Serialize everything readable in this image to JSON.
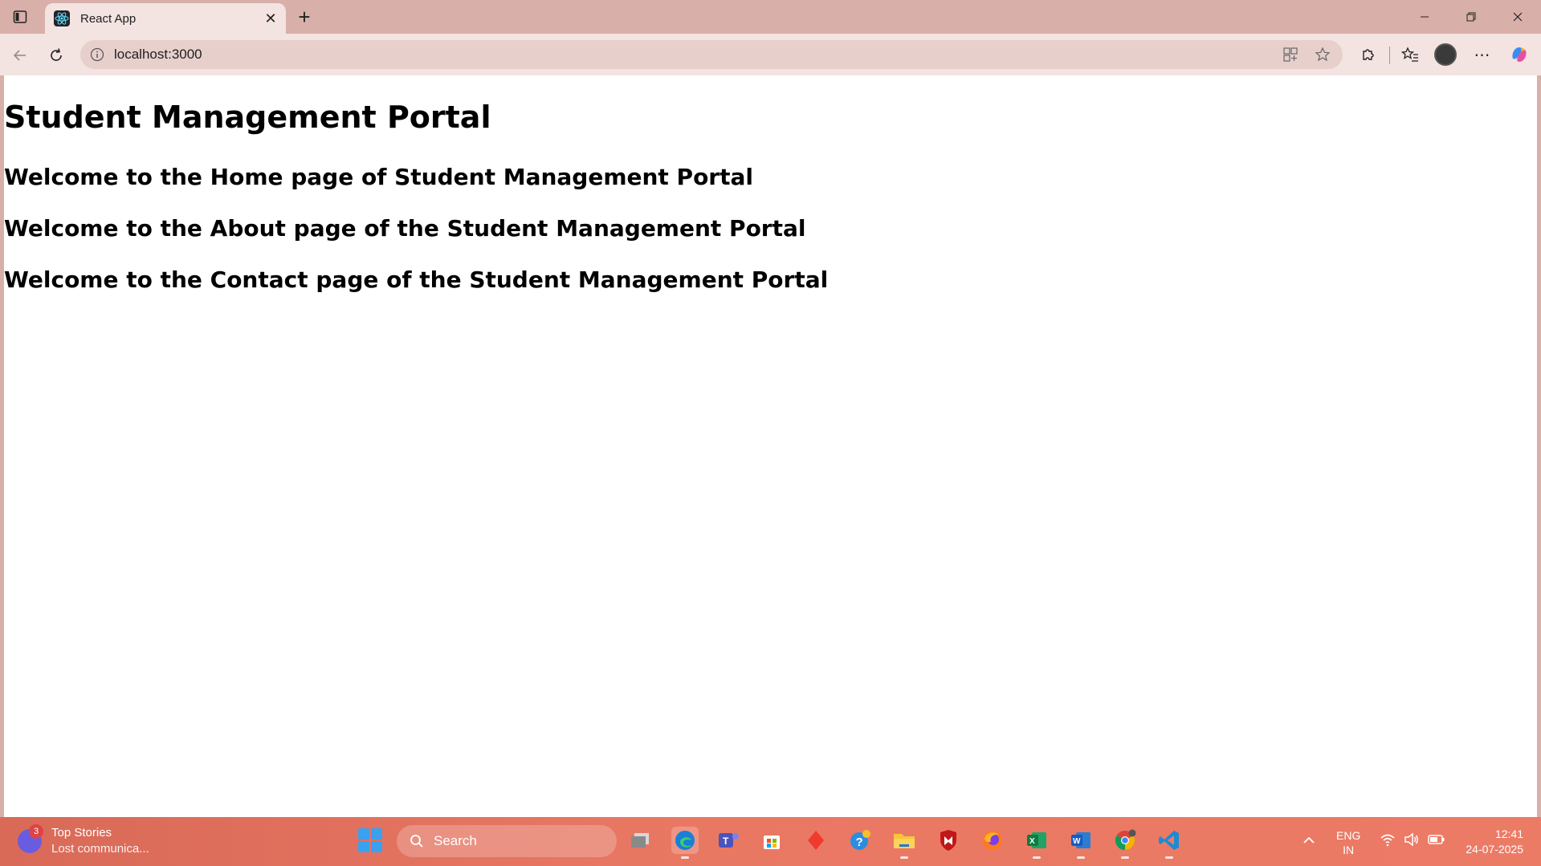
{
  "browser": {
    "tab": {
      "title": "React App",
      "favicon": "react-logo-icon"
    },
    "address": {
      "url": "localhost:3000"
    },
    "colors": {
      "frame": "#d9afaa",
      "toolbar": "#f3e3e1",
      "omnibox": "#e7cfcc"
    }
  },
  "page": {
    "title": "Student Management Portal",
    "sections": [
      "Welcome to the Home page of Student Management Portal",
      "Welcome to the About page of the Student Management Portal",
      "Welcome to the Contact page of the Student Management Portal"
    ]
  },
  "taskbar": {
    "news": {
      "badge": "3",
      "title": "Top Stories",
      "subtitle": "Lost communica..."
    },
    "search": {
      "label": "Search"
    },
    "apps": [
      "task-view-icon",
      "edge-icon",
      "teams-icon",
      "store-icon",
      "red-diamond-app-icon",
      "help-icon",
      "file-explorer-icon",
      "mcafee-icon",
      "firefox-icon",
      "excel-icon",
      "word-icon",
      "chrome-icon",
      "vscode-icon"
    ],
    "tray": {
      "lang_top": "ENG",
      "lang_bottom": "IN"
    },
    "clock": {
      "time": "12:41",
      "date": "24-07-2025"
    }
  }
}
